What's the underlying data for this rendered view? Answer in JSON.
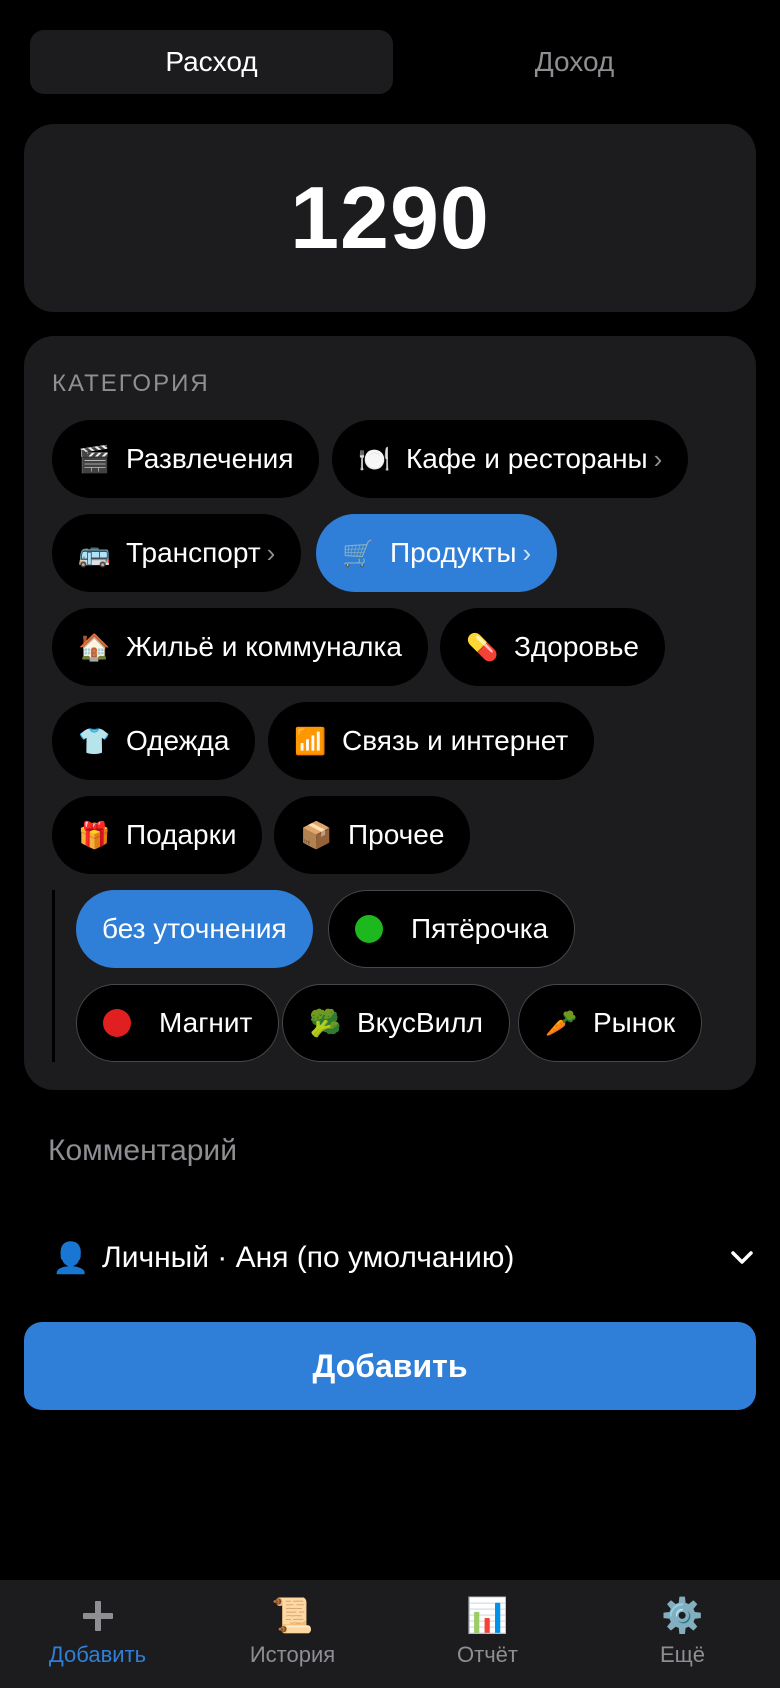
{
  "toggle": {
    "expense": "Расход",
    "income": "Доход"
  },
  "amount": "1290",
  "category": {
    "title": "КАТЕГОРИЯ",
    "chips": [
      {
        "emoji": "🎬",
        "label": "Развлечения",
        "chev": ""
      },
      {
        "emoji": "🍽️",
        "label": "Кафе и рестораны",
        "chev": "›"
      },
      {
        "emoji": "🚌",
        "label": "Транспорт",
        "chev": "›"
      },
      {
        "emoji": "🛒",
        "label": "Продукты",
        "chev": "›"
      },
      {
        "emoji": "🏠",
        "label": "Жильё и коммуналка",
        "chev": ""
      },
      {
        "emoji": "💊",
        "label": "Здоровье",
        "chev": ""
      },
      {
        "emoji": "👕",
        "label": "Одежда",
        "chev": ""
      },
      {
        "emoji": "📶",
        "label": "Связь и интернет",
        "chev": ""
      },
      {
        "emoji": "🎁",
        "label": "Подарки",
        "chev": ""
      },
      {
        "emoji": "📦",
        "label": "Прочее",
        "chev": ""
      }
    ],
    "subchips": [
      {
        "emoji": "",
        "label": "без уточнения"
      },
      {
        "emoji": "",
        "label": "Пятёрочка",
        "dot": "#1db81d"
      },
      {
        "emoji": "",
        "label": "Магнит",
        "dot": "#e02020"
      },
      {
        "emoji": "🥦",
        "label": "ВкусВилл"
      },
      {
        "emoji": "🥕",
        "label": "Рынок"
      }
    ]
  },
  "comment_placeholder": "Комментарий",
  "account": {
    "icon": "👤",
    "text": "Личный · Аня (по умолчанию)"
  },
  "add_button": "Добавить",
  "tabbar": [
    {
      "icon": "plus-icon",
      "label": "Добавить",
      "active": true
    },
    {
      "icon": "scroll-icon",
      "glyph": "📜",
      "label": "История"
    },
    {
      "icon": "bar-chart-icon",
      "glyph": "📊",
      "label": "Отчёт"
    },
    {
      "icon": "gear-icon",
      "glyph": "⚙️",
      "label": "Ещё"
    }
  ],
  "colors": {
    "accent": "#2f7fd8",
    "card": "#1c1c1e",
    "muted": "#8e8e93"
  }
}
